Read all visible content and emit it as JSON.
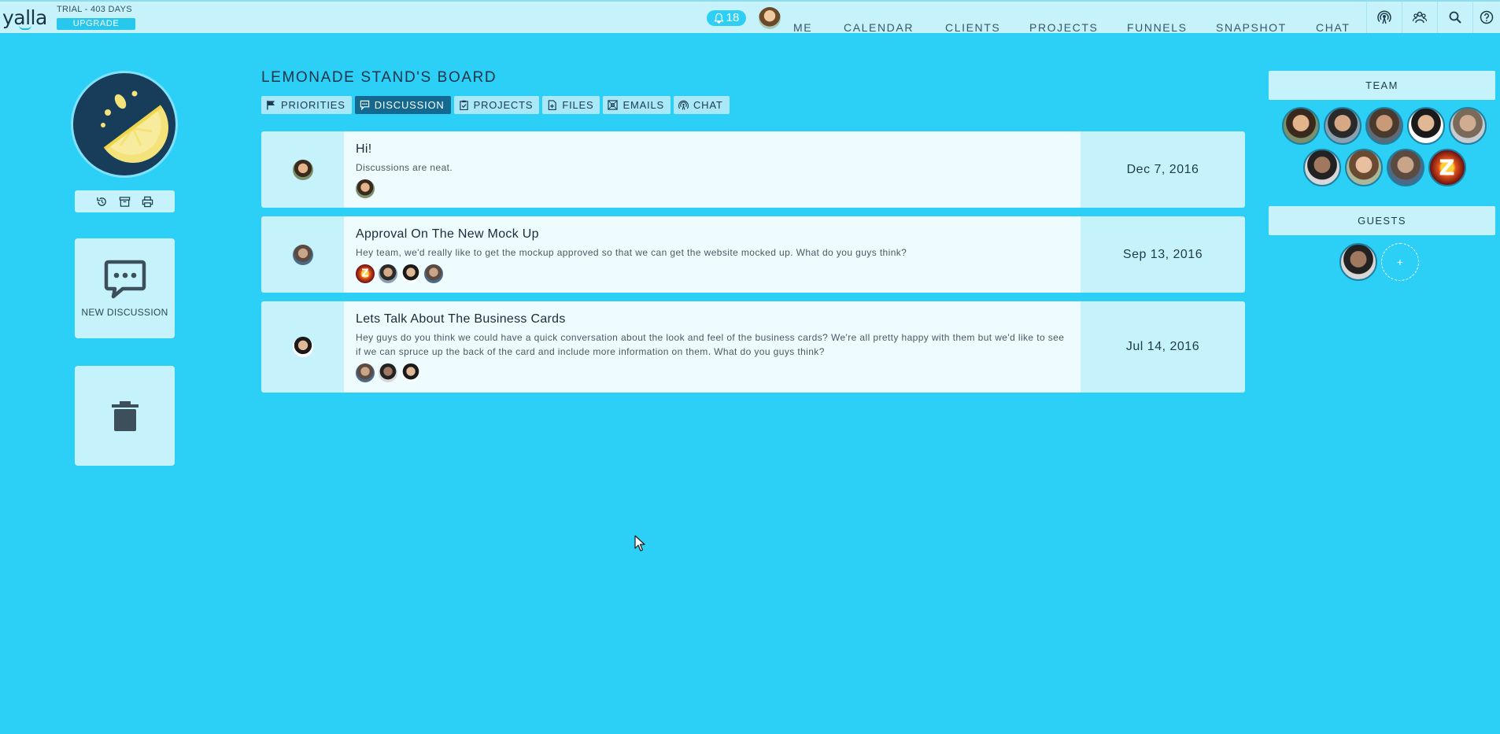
{
  "app": {
    "logo": "yalla",
    "trial": "TRIAL - 403 DAYS",
    "upgrade": "UPGRADE",
    "notifications": "18"
  },
  "nav": {
    "me": "ME",
    "calendar": "CALENDAR",
    "clients": "CLIENTS",
    "projects": "PROJECTS",
    "funnels": "FUNNELS",
    "snapshot": "SNAPSHOT",
    "chat": "CHAT"
  },
  "tools": [
    "broadcast-icon",
    "team-icon",
    "search-icon",
    "help-icon"
  ],
  "board": {
    "title": "LEMONADE STAND'S BOARD",
    "tabs": [
      {
        "label": "PRIORITIES",
        "icon": "flag-icon"
      },
      {
        "label": "DISCUSSION",
        "icon": "discussion-icon",
        "active": true
      },
      {
        "label": "PROJECTS",
        "icon": "clipboard-icon"
      },
      {
        "label": "FILES",
        "icon": "file-icon"
      },
      {
        "label": "EMAILS",
        "icon": "email-icon"
      },
      {
        "label": "CHAT",
        "icon": "chat-icon"
      }
    ]
  },
  "sidebar": {
    "actions": [
      "history-icon",
      "archive-icon",
      "print-icon"
    ],
    "new_discussion": "NEW DISCUSSION"
  },
  "discussions": [
    {
      "title": "Hi!",
      "text": "Discussions are neat.",
      "date": "Dec 7, 2016"
    },
    {
      "title": "Approval On The New Mock Up",
      "text": "Hey team, we'd really like to get the mockup approved so that we can get the website mocked up.  What do you guys think?",
      "date": "Sep 13, 2016"
    },
    {
      "title": "Lets Talk About The Business Cards",
      "text": "Hey guys do you think we could have a quick conversation about the look and feel of the business cards?  We're all pretty happy with them but we'd like to see if we can spruce up the back of the card and include more information on them. What do you guys think?",
      "date": "Jul 14, 2016"
    }
  ],
  "right": {
    "team_title": "TEAM",
    "guests_title": "GUESTS",
    "add_guest": "+"
  },
  "colors": {
    "background": "#2cd0f7",
    "panel": "#c6f2fc",
    "card": "#eefbff",
    "active_tab": "#13698f"
  }
}
